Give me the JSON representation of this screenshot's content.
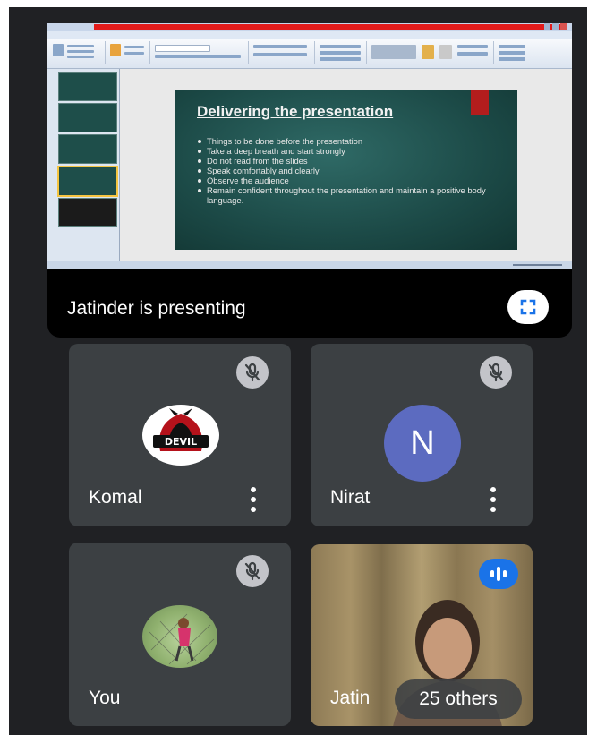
{
  "presentation": {
    "presenting_label": "Jatinder is presenting",
    "slide": {
      "title": "Delivering the presentation",
      "bullets": [
        "Things to be done before the presentation",
        "Take a deep breath and start strongly",
        "Do not read from the slides",
        "Speak comfortably and clearly",
        "Observe the audience",
        "Remain confident throughout the presentation and maintain a positive body language."
      ]
    },
    "fullscreen_icon": "fullscreen-icon"
  },
  "participants": [
    {
      "name": "Komal",
      "avatar": "DEVIL",
      "muted": true
    },
    {
      "name": "Nirat",
      "avatar_letter": "N",
      "muted": true
    },
    {
      "name": "You",
      "muted": true
    },
    {
      "name": "Jatin",
      "speaking": true,
      "others_label": "25 others"
    }
  ],
  "colors": {
    "background": "#202124",
    "tile": "#3c4043",
    "speaking_accent": "#1a73e8",
    "avatar_n": "#5c6bc0",
    "slide_bg": "#1c4a47"
  }
}
